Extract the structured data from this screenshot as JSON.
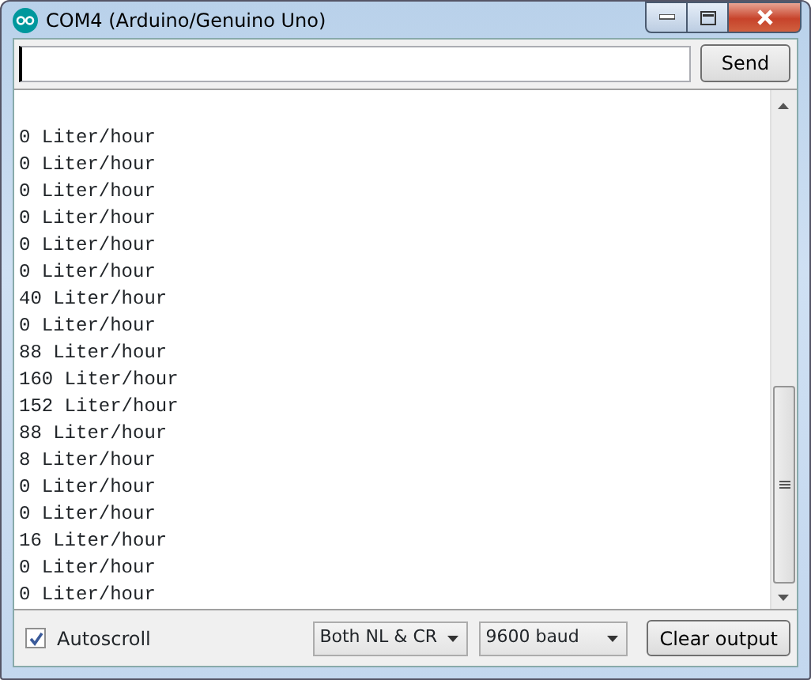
{
  "window": {
    "title": "COM4 (Arduino/Genuino Uno)"
  },
  "send_button": "Send",
  "output_lines": [
    "0 Liter/hour",
    "0 Liter/hour",
    "0 Liter/hour",
    "0 Liter/hour",
    "0 Liter/hour",
    "0 Liter/hour",
    "40 Liter/hour",
    "0 Liter/hour",
    "88 Liter/hour",
    "160 Liter/hour",
    "152 Liter/hour",
    "88 Liter/hour",
    "8 Liter/hour",
    "0 Liter/hour",
    "0 Liter/hour",
    "16 Liter/hour",
    "0 Liter/hour",
    "0 Liter/hour"
  ],
  "autoscroll": {
    "label": "Autoscroll",
    "checked": true
  },
  "line_ending": "Both NL & CR",
  "baud_rate": "9600 baud",
  "clear_button": "Clear output"
}
